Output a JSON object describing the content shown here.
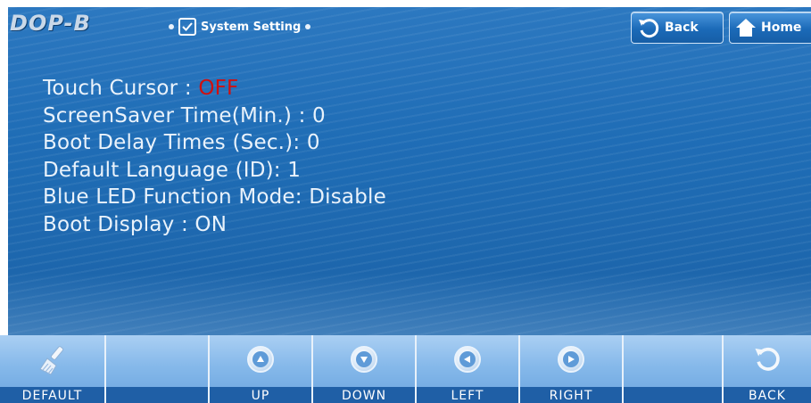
{
  "header": {
    "logo": "DOP-B",
    "title": "System Setting",
    "back_label": "Back",
    "home_label": "Home"
  },
  "settings": {
    "touch_cursor": {
      "label": "Touch Cursor : ",
      "value": "OFF",
      "value_color": "#d01010"
    },
    "screensaver": {
      "text": "ScreenSaver Time(Min.) : 0"
    },
    "boot_delay": {
      "text": "Boot Delay Times (Sec.): 0"
    },
    "default_language": {
      "text": "Default Language (ID): 1"
    },
    "blue_led": {
      "text": "Blue LED Function Mode: Disable"
    },
    "boot_display": {
      "text": "Boot Display : ON"
    }
  },
  "toolbar": {
    "default_label": "DEFAULT",
    "up_label": "UP",
    "down_label": "DOWN",
    "left_label": "LEFT",
    "right_label": "RIGHT",
    "back_label": "BACK"
  },
  "colors": {
    "background_blue": "#1f6db6",
    "toolbar_label_bg": "#1f5fa6",
    "text": "#e9f2fb"
  }
}
